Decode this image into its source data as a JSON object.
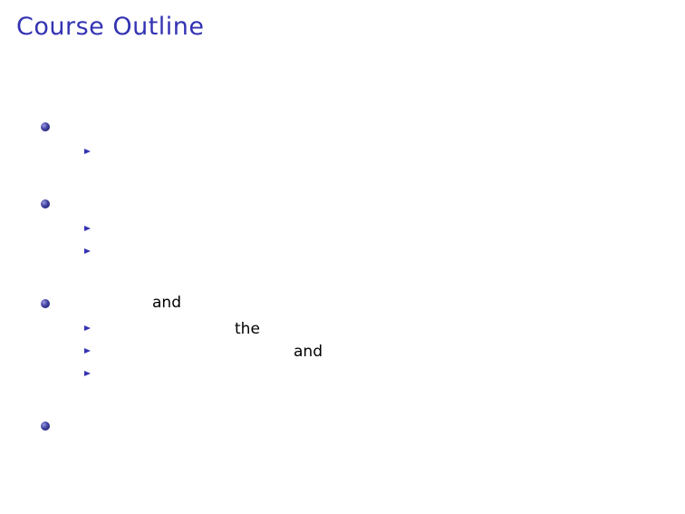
{
  "slide": {
    "title": "Course Outline",
    "visible_words": [
      "and",
      "the",
      "and"
    ],
    "bullet_color": "#3333b3",
    "title_color": "#3333b3"
  }
}
